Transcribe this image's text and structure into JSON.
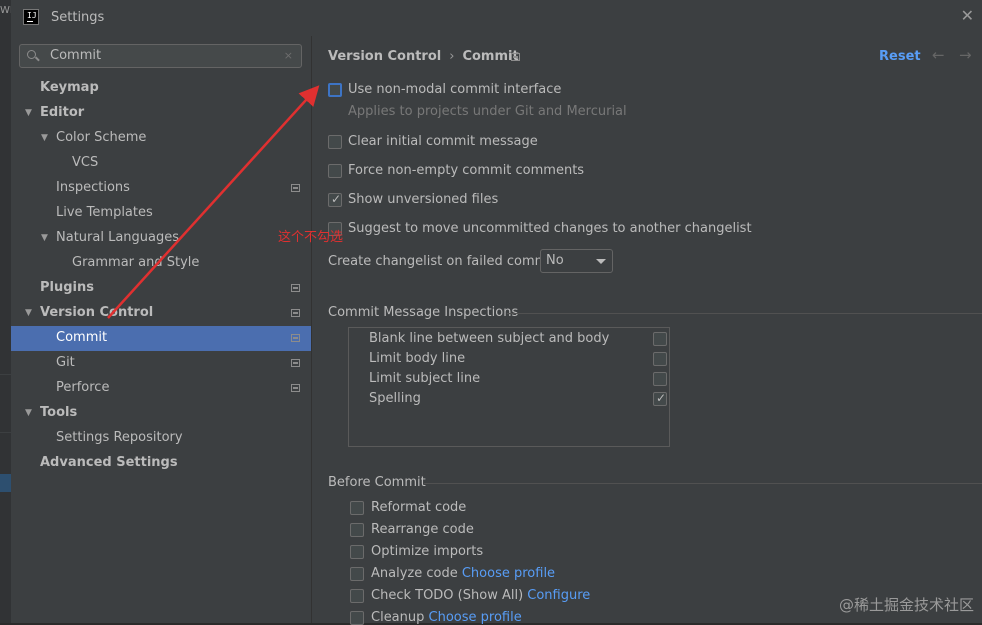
{
  "window": {
    "title": "Settings"
  },
  "background_edge": {
    "text": "WM"
  },
  "search": {
    "value": "Commit",
    "clear": "×"
  },
  "tree": [
    {
      "label": "Keymap"
    },
    {
      "label": "Editor"
    },
    {
      "label": "Color Scheme"
    },
    {
      "label": "VCS"
    },
    {
      "label": "Inspections"
    },
    {
      "label": "Live Templates"
    },
    {
      "label": "Natural Languages"
    },
    {
      "label": "Grammar and Style"
    },
    {
      "label": "Plugins"
    },
    {
      "label": "Version Control"
    },
    {
      "label": "Commit"
    },
    {
      "label": "Git"
    },
    {
      "label": "Perforce"
    },
    {
      "label": "Tools"
    },
    {
      "label": "Settings Repository"
    },
    {
      "label": "Advanced Settings"
    }
  ],
  "breadcrumb": {
    "parent": "Version Control",
    "separator": "›",
    "current": "Commit"
  },
  "header": {
    "reset": "Reset",
    "back": "←",
    "forward": "→"
  },
  "options": {
    "non_modal": {
      "label": "Use non-modal commit interface",
      "checked": false,
      "hint": "Applies to projects under Git and Mercurial"
    },
    "clear_msg": {
      "label": "Clear initial commit message",
      "checked": false
    },
    "force_nonempty": {
      "label": "Force non-empty commit comments",
      "checked": false
    },
    "show_unversioned": {
      "label": "Show unversioned files",
      "checked": true
    },
    "suggest_move": {
      "label": "Suggest to move uncommitted changes to another changelist",
      "checked": false
    },
    "create_changelist": {
      "label": "Create changelist on failed commit:",
      "value": "No"
    }
  },
  "inspections": {
    "title": "Commit Message Inspections",
    "items": [
      {
        "label": "Blank line between subject and body",
        "checked": false
      },
      {
        "label": "Limit body line",
        "checked": false
      },
      {
        "label": "Limit subject line",
        "checked": false
      },
      {
        "label": "Spelling",
        "checked": true
      }
    ]
  },
  "before_commit": {
    "title": "Before Commit",
    "items": [
      {
        "label": "Reformat code",
        "link": ""
      },
      {
        "label": "Rearrange code",
        "link": ""
      },
      {
        "label": "Optimize imports",
        "link": ""
      },
      {
        "label": "Analyze code",
        "link": "Choose profile"
      },
      {
        "label": "Check TODO (Show All)",
        "link": "Configure"
      },
      {
        "label": "Cleanup",
        "link": "Choose profile"
      }
    ]
  },
  "annotation": {
    "text": "这个不勾选",
    "color": "#e03030"
  },
  "watermark": "@稀土掘金技术社区",
  "colors": {
    "selection": "#4b6eaf",
    "link": "#589df6",
    "focus": "#3d74c5",
    "annotation": "#e03030"
  }
}
